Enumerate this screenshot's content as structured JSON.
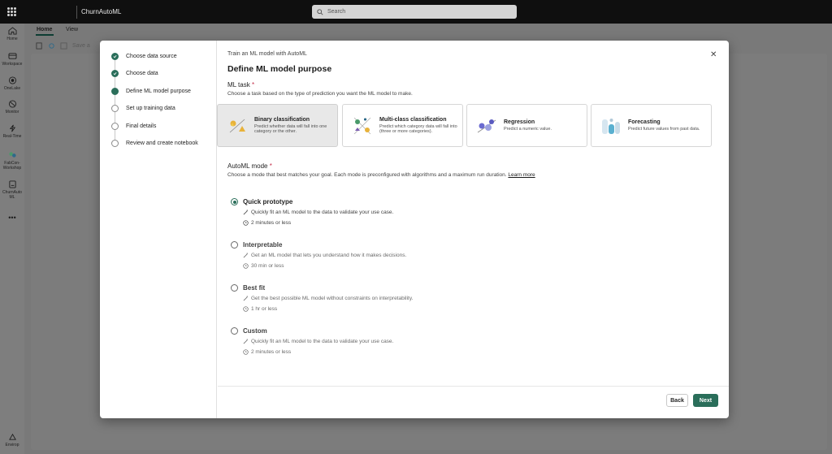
{
  "topbar": {
    "app_name": "ChurnAutoML",
    "search_placeholder": "Search"
  },
  "rail": {
    "items": [
      "Home",
      "Workspace",
      "OneLake",
      "Monitor",
      "Real-Time",
      "FabCon-Workshop",
      "ChurnAuto ML"
    ],
    "more": "•••",
    "bottom": "Envirop"
  },
  "ribbon": {
    "tabs": [
      "Home",
      "View"
    ],
    "save_label": "Save a"
  },
  "wizard": {
    "steps": [
      {
        "label": "Choose data source",
        "state": "done"
      },
      {
        "label": "Choose data",
        "state": "done"
      },
      {
        "label": "Define ML model purpose",
        "state": "current"
      },
      {
        "label": "Set up training data",
        "state": "pending"
      },
      {
        "label": "Final details",
        "state": "pending"
      },
      {
        "label": "Review and create notebook",
        "state": "pending"
      }
    ]
  },
  "dialog": {
    "subtitle": "Train an ML model with AutoML",
    "title": "Define ML model purpose",
    "close_label": "✕",
    "ml_task": {
      "label": "ML task",
      "required_mark": "*",
      "description": "Choose a task based on the type of prediction you want the ML model to make.",
      "cards": [
        {
          "title": "Binary classification",
          "desc": "Predict whether data will fall into one category or the other.",
          "selected": true,
          "icon": "binary-classification-icon"
        },
        {
          "title": "Multi-class classification",
          "desc": "Predict which category data will fall into (three or more categories).",
          "selected": false,
          "icon": "multiclass-classification-icon"
        },
        {
          "title": "Regression",
          "desc": "Predict a numeric value.",
          "selected": false,
          "icon": "regression-icon"
        },
        {
          "title": "Forecasting",
          "desc": "Predict future values from past data.",
          "selected": false,
          "icon": "forecasting-icon"
        }
      ]
    },
    "automl_mode": {
      "label": "AutoML mode",
      "required_mark": "*",
      "description": "Choose a mode that best matches your goal. Each mode is preconfigured with algorithms and a maximum run duration.",
      "learn_more": "Learn more",
      "options": [
        {
          "title": "Quick prototype",
          "desc": "Quickly fit an ML model to the data to validate your use case.",
          "duration": "2 minutes or less",
          "selected": true
        },
        {
          "title": "Interpretable",
          "desc": "Get an ML model that lets you understand how it makes decisions.",
          "duration": "30 min or less",
          "selected": false
        },
        {
          "title": "Best fit",
          "desc": "Get the best possible ML model without constraints on interpretability.",
          "duration": "1 hr or less",
          "selected": false
        },
        {
          "title": "Custom",
          "desc": "Quickly fit an ML model to the data to validate your use case.",
          "duration": "2 minutes or less",
          "selected": false
        }
      ]
    },
    "footer": {
      "back": "Back",
      "next": "Next"
    }
  },
  "colors": {
    "accent": "#2a6e5a",
    "required": "#c4314b"
  }
}
